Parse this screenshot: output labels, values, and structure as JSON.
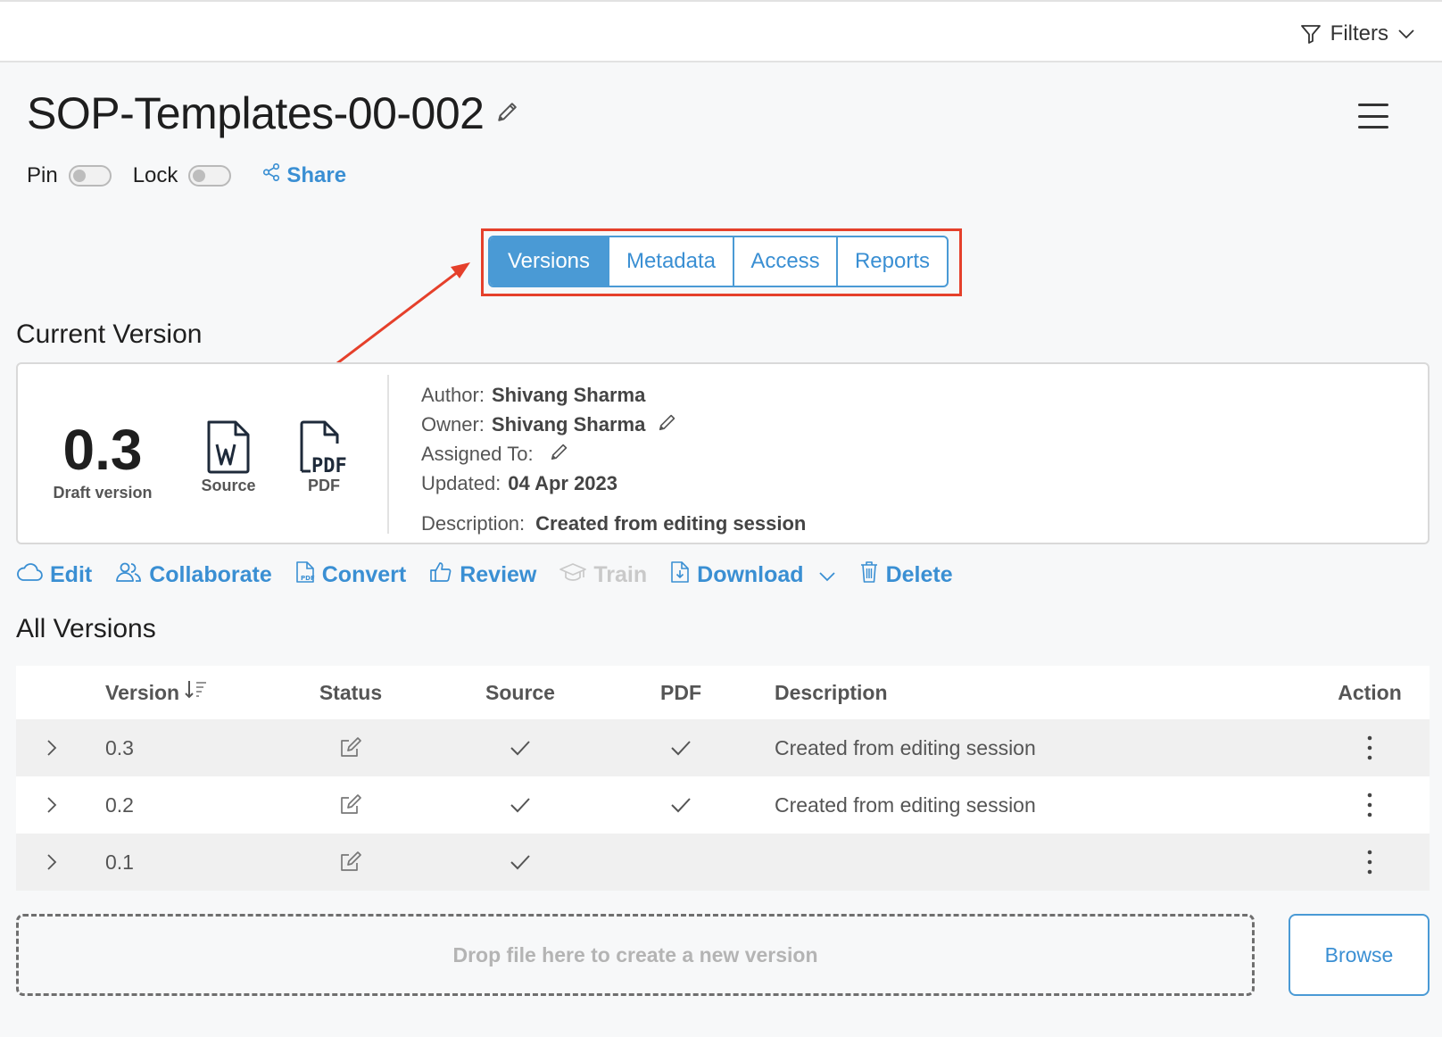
{
  "header": {
    "filters_label": "Filters"
  },
  "document": {
    "title": "SOP-Templates-00-002"
  },
  "toggles": {
    "pin_label": "Pin",
    "lock_label": "Lock",
    "share_label": "Share"
  },
  "tabs": [
    {
      "label": "Versions",
      "active": true
    },
    {
      "label": "Metadata",
      "active": false
    },
    {
      "label": "Access",
      "active": false
    },
    {
      "label": "Reports",
      "active": false
    }
  ],
  "current_version": {
    "section_title": "Current Version",
    "version": "0.3",
    "version_label": "Draft version",
    "source_label": "Source",
    "pdf_label": "PDF",
    "author_label": "Author:",
    "author": "Shivang Sharma",
    "owner_label": "Owner:",
    "owner": "Shivang Sharma",
    "assigned_label": "Assigned To:",
    "updated_label": "Updated:",
    "updated": "04 Apr 2023",
    "description_label": "Description:",
    "description": "Created from editing session"
  },
  "actions": {
    "edit": "Edit",
    "collaborate": "Collaborate",
    "convert": "Convert",
    "review": "Review",
    "train": "Train",
    "download": "Download",
    "delete": "Delete"
  },
  "all_versions": {
    "section_title": "All Versions",
    "columns": {
      "version": "Version",
      "status": "Status",
      "source": "Source",
      "pdf": "PDF",
      "description": "Description",
      "action": "Action"
    },
    "rows": [
      {
        "version": "0.3",
        "source": true,
        "pdf": true,
        "description": "Created from editing session"
      },
      {
        "version": "0.2",
        "source": true,
        "pdf": true,
        "description": "Created from editing session"
      },
      {
        "version": "0.1",
        "source": true,
        "pdf": false,
        "description": ""
      }
    ]
  },
  "dropzone": {
    "text": "Drop file here to create a new version",
    "browse_label": "Browse"
  },
  "colors": {
    "accent": "#4a9ad5",
    "highlight": "#e5402b"
  }
}
